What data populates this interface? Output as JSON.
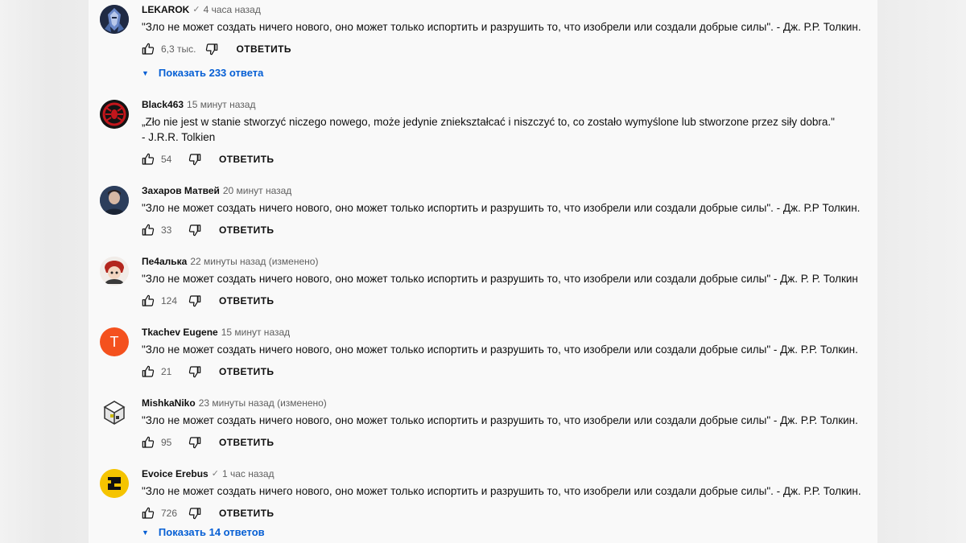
{
  "comments": [
    {
      "author": "LEKAROK",
      "verified": true,
      "time": "4 часа назад",
      "text_lines": [
        "\"Зло не может создать ничего нового, оно может только испортить и разрушить то, что изобрели или создали добрые силы\". - Дж. Р.Р. Толкин."
      ],
      "likes": "6,3 тыс.",
      "reply_label": "ОТВЕТИТЬ",
      "replies_label": "Показать 233 ответа",
      "avatar_icon": "armored-knight-avatar"
    },
    {
      "author": "Black463",
      "verified": false,
      "time": "15 минут назад",
      "text_lines": [
        "„Zło nie jest w stanie stworzyć niczego nowego, może jedynie zniekształcać i niszczyć to, co zostało wymyślone lub stworzone przez siły dobra.\"",
        "- J.R.R. Tolkien"
      ],
      "likes": "54",
      "reply_label": "ОТВЕТИТЬ",
      "avatar_icon": "spider-emblem-avatar"
    },
    {
      "author": "Захаров Матвей",
      "verified": false,
      "time": "20 минут назад",
      "text_lines": [
        "\"Зло не может создать ничего нового, оно может только испортить и разрушить то, что изобрели или создали добрые силы\". - Дж. Р.Р Толкин."
      ],
      "likes": "33",
      "reply_label": "ОТВЕТИТЬ",
      "avatar_icon": "portrait-avatar"
    },
    {
      "author": "Пе4алька",
      "verified": false,
      "time": "22 минуты назад (изменено)",
      "text_lines": [
        "\"Зло не может создать ничего нового, оно может только испортить и разрушить то, что изобрели или создали добрые силы\" - Дж. Р. Р. Толкин"
      ],
      "likes": "124",
      "reply_label": "ОТВЕТИТЬ",
      "avatar_icon": "anime-character-avatar"
    },
    {
      "author": "Tkachev Eugene",
      "verified": false,
      "time": "15 минут назад",
      "text_lines": [
        "\"Зло не может создать ничего нового, оно может только испортить и разрушить то, что изобрели или создали добрые силы\" - Дж. Р.Р. Толкин."
      ],
      "likes": "21",
      "reply_label": "ОТВЕТИТЬ",
      "avatar_letter": "T",
      "avatar_icon": "letter-avatar"
    },
    {
      "author": "MishkaNiko",
      "verified": false,
      "time": "23 минуты назад (изменено)",
      "text_lines": [
        "\"Зло не может создать ничего нового, оно может только испортить и разрушить то, что изобрели или создали добрые силы\" - Дж. Р.Р. Толкин."
      ],
      "likes": "95",
      "reply_label": "ОТВЕТИТЬ",
      "avatar_icon": "pixel-cube-avatar"
    },
    {
      "author": "Evoice Erebus",
      "verified": true,
      "time": "1 час назад",
      "text_lines": [
        "\"Зло не может создать ничего нового, оно может только испортить и разрушить то, что изобрели или создали добрые силы\". - Дж. Р.Р. Толкин."
      ],
      "likes": "726",
      "reply_label": "ОТВЕТИТЬ",
      "replies_label": "Показать 14 ответов",
      "avatar_icon": "maze-logo-avatar"
    }
  ],
  "colors": {
    "link": "#065fd4",
    "meta": "#606060",
    "background": "#f9f9f9",
    "avatar_orange": "#f4511e",
    "avatar_yellow": "#f5c400"
  }
}
